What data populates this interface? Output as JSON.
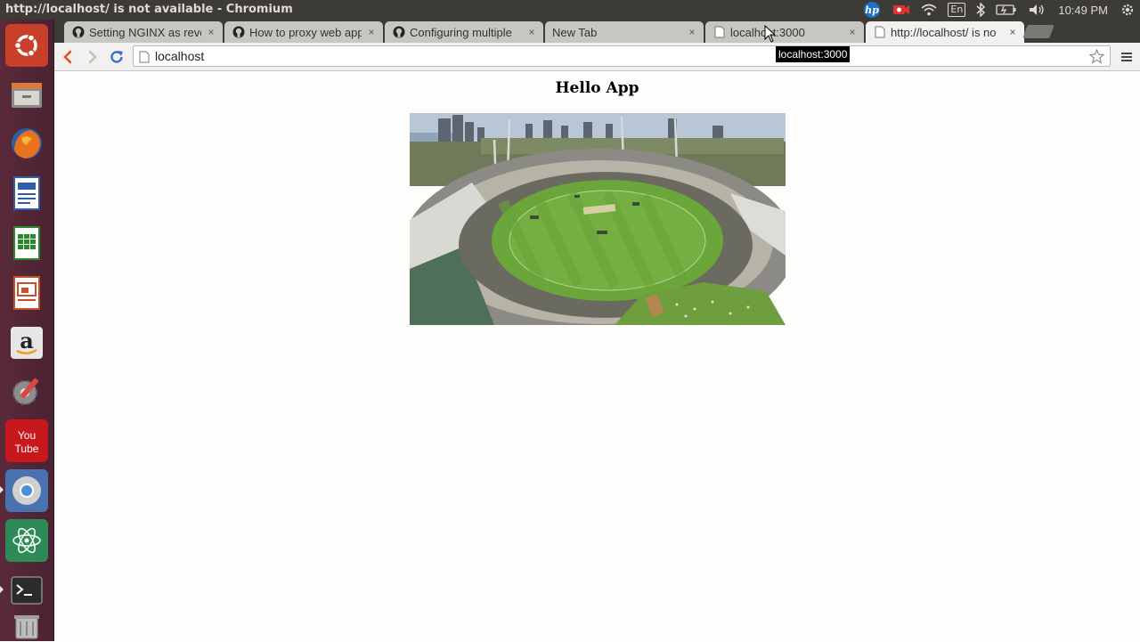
{
  "system": {
    "window_title": "http://localhost/ is not available - Chromium",
    "input_language": "En",
    "clock": "10:49 PM",
    "tray_icons": [
      "hp-icon",
      "recording-icon",
      "wifi-icon",
      "keyboard-language-icon",
      "bluetooth-icon",
      "battery-icon",
      "volume-icon",
      "settings-gear-icon"
    ]
  },
  "launcher": {
    "items": [
      {
        "name": "ubuntu-dash-icon"
      },
      {
        "name": "files-icon"
      },
      {
        "name": "firefox-icon"
      },
      {
        "name": "libreoffice-writer-icon"
      },
      {
        "name": "libreoffice-calc-icon"
      },
      {
        "name": "libreoffice-impress-icon"
      },
      {
        "name": "amazon-icon"
      },
      {
        "name": "system-settings-icon"
      },
      {
        "name": "youtube-icon",
        "label_top": "You",
        "label_bottom": "Tube"
      },
      {
        "name": "chromium-icon"
      },
      {
        "name": "atom-editor-icon"
      },
      {
        "name": "terminal-icon"
      },
      {
        "name": "trash-icon"
      }
    ]
  },
  "tabs": [
    {
      "title": "Setting NGINX as reve",
      "favicon": "github-icon",
      "active": false
    },
    {
      "title": "How to proxy web app",
      "favicon": "github-icon",
      "active": false
    },
    {
      "title": "Configuring multiple",
      "favicon": "github-icon",
      "active": false
    },
    {
      "title": "New Tab",
      "favicon": "",
      "active": false
    },
    {
      "title": "localhost:3000",
      "favicon": "page-icon",
      "active": false
    },
    {
      "title": "http://localhost/ is no",
      "favicon": "page-icon",
      "active": true
    }
  ],
  "tab_close_glyph": "×",
  "toolbar": {
    "address": "localhost",
    "tooltip": "localhost:3000"
  },
  "page": {
    "heading": "Hello App",
    "image_alt": "aerial view of cricket stadium"
  },
  "colors": {
    "panel": "#3c3b37",
    "launcher": "#4b2433",
    "back_arrow": "#e0541c",
    "reload": "#3b6ec9"
  }
}
